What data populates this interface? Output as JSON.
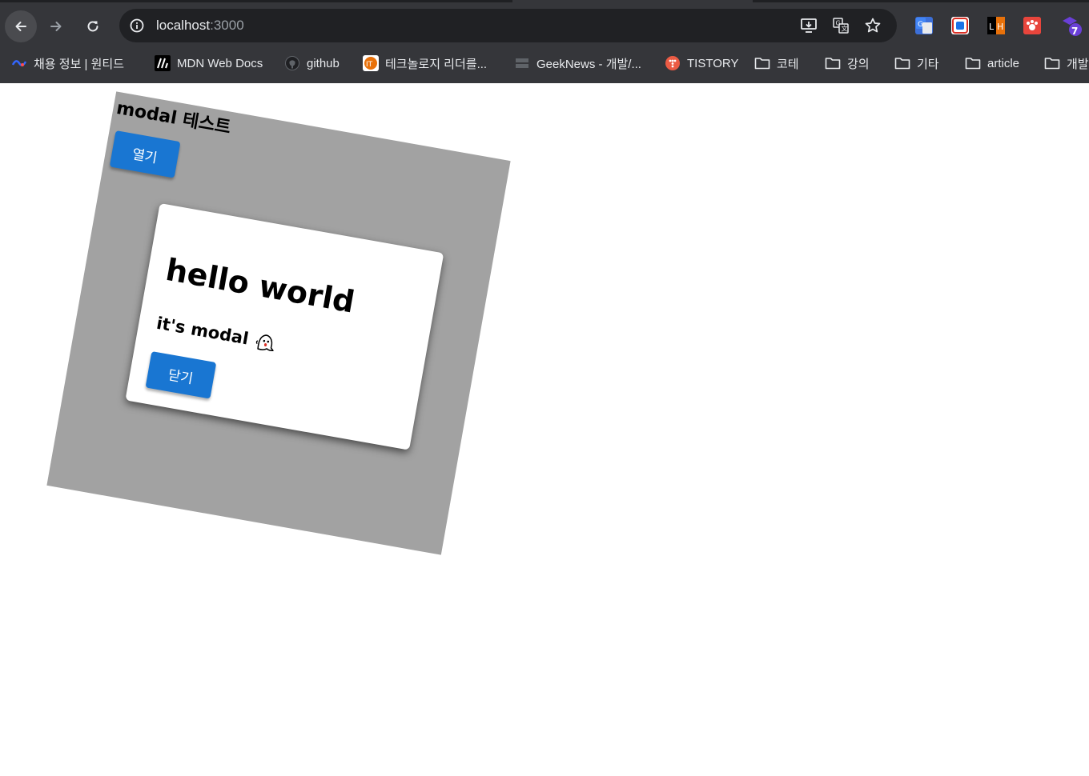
{
  "browser": {
    "url_host": "localhost",
    "url_port": ":3000",
    "extension_badge": "7",
    "bookmarks": [
      {
        "label": "채용 정보 | 원티드"
      },
      {
        "label": "MDN Web Docs"
      },
      {
        "label": "github"
      },
      {
        "label": "테크놀로지 리더를..."
      },
      {
        "label": "GeekNews - 개발/..."
      },
      {
        "label": "TISTORY"
      },
      {
        "label": "코테"
      },
      {
        "label": "강의"
      },
      {
        "label": "기타"
      },
      {
        "label": "article"
      },
      {
        "label": "개발"
      }
    ]
  },
  "page": {
    "title": "modal 테스트",
    "open_button": "열기"
  },
  "modal": {
    "title": "hello world",
    "subtitle": "it's modal",
    "close_button": "닫기"
  },
  "colors": {
    "chrome_bg": "#35363a",
    "omnibox_bg": "#202124",
    "container_bg": "#a2a2a2",
    "button_bg": "#1976d2"
  }
}
